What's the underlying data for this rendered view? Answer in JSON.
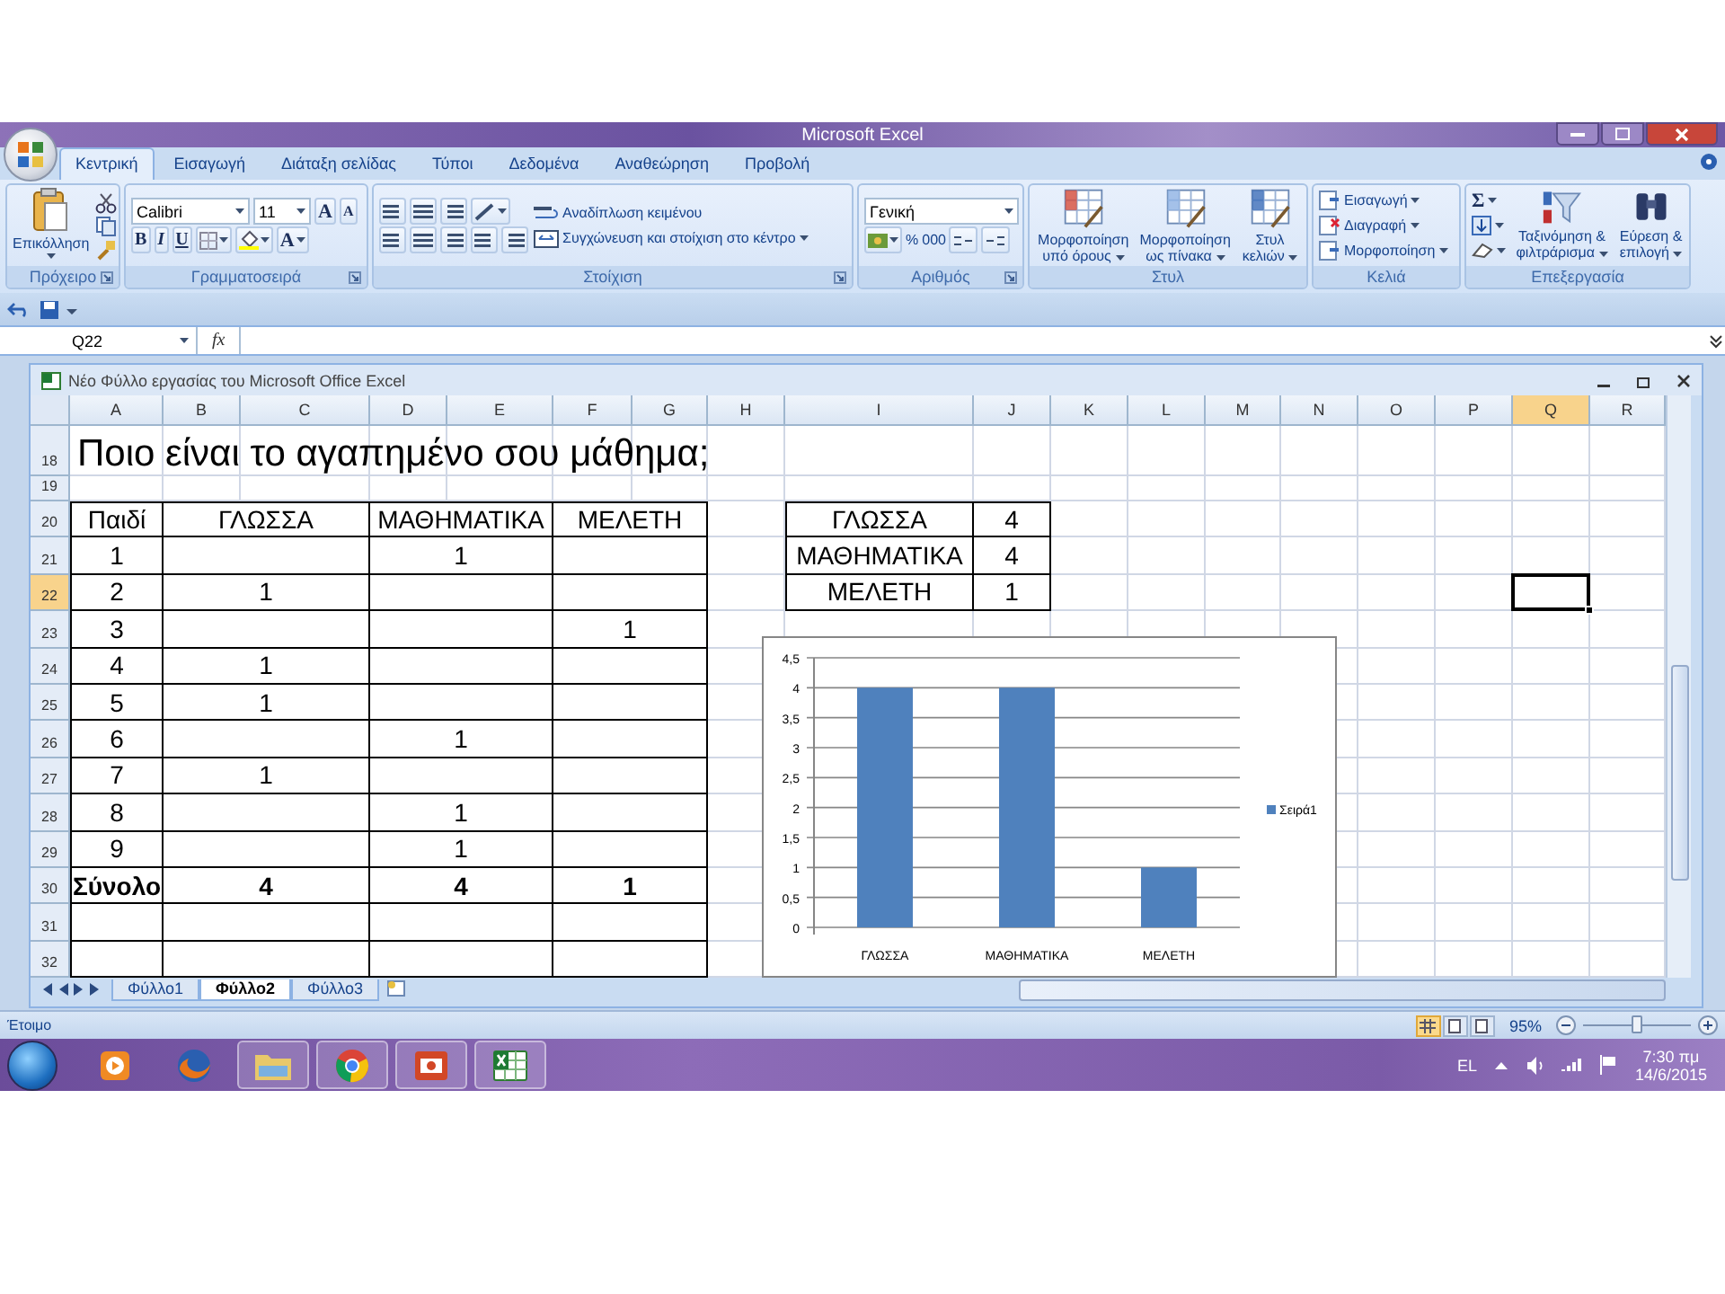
{
  "window": {
    "title": "Microsoft Excel"
  },
  "ribbon": {
    "tabs": [
      {
        "label": "Κεντρική",
        "selected": true
      },
      {
        "label": "Εισαγωγή",
        "selected": false
      },
      {
        "label": "Διάταξη σελίδας",
        "selected": false
      },
      {
        "label": "Τύποι",
        "selected": false
      },
      {
        "label": "Δεδομένα",
        "selected": false
      },
      {
        "label": "Αναθεώρηση",
        "selected": false
      },
      {
        "label": "Προβολή",
        "selected": false
      }
    ],
    "groups": [
      {
        "kind": "clipboard",
        "label": "Πρόχειρο",
        "launcher": true,
        "paste": "Επικόλληση"
      },
      {
        "kind": "font",
        "label": "Γραμματοσειρά",
        "launcher": true,
        "font": "Calibri",
        "size": "11",
        "grow": "A",
        "shrink": "A",
        "styles": [
          "B",
          "I",
          "U"
        ],
        "color_letter": "A"
      },
      {
        "kind": "alignment",
        "label": "Στοίχιση",
        "launcher": true,
        "wrap": "Αναδίπλωση κειμένου",
        "merge": "Συγχώνευση και στοίχιση στο κέντρο"
      },
      {
        "kind": "number",
        "label": "Αριθμός",
        "launcher": true,
        "format": "Γενική",
        "percent": "%",
        "thousands": "000"
      },
      {
        "kind": "styles",
        "label": "Στυλ",
        "launcher": false,
        "buttons": [
          "Μορφοποίηση υπό όρους",
          "Μορφοποίηση ως πίνακα",
          "Στυλ κελιών"
        ]
      },
      {
        "kind": "cells",
        "label": "Κελιά",
        "launcher": false,
        "buttons": [
          "Εισαγωγή",
          "Διαγραφή",
          "Μορφοποίηση"
        ]
      },
      {
        "kind": "editing",
        "label": "Επεξεργασία",
        "launcher": false,
        "sum": "Σ",
        "buttons": [
          "Ταξινόμηση & φιλτράρισμα",
          "Εύρεση & επιλογή"
        ]
      }
    ]
  },
  "formula_bar": {
    "name_box": "Q22",
    "function_label": "fx"
  },
  "workbook": {
    "title": "Νέο Φύλλο εργασίας του Microsoft Office Excel",
    "columns": [
      {
        "label": "A",
        "selected": false
      },
      {
        "label": "B",
        "selected": false
      },
      {
        "label": "C",
        "selected": false
      },
      {
        "label": "D",
        "selected": false
      },
      {
        "label": "E",
        "selected": false
      },
      {
        "label": "F",
        "selected": false
      },
      {
        "label": "G",
        "selected": false
      },
      {
        "label": "H",
        "selected": false
      },
      {
        "label": "I",
        "selected": false
      },
      {
        "label": "J",
        "selected": false
      },
      {
        "label": "K",
        "selected": false
      },
      {
        "label": "L",
        "selected": false
      },
      {
        "label": "M",
        "selected": false
      },
      {
        "label": "N",
        "selected": false
      },
      {
        "label": "O",
        "selected": false
      },
      {
        "label": "P",
        "selected": false
      },
      {
        "label": "Q",
        "selected": true
      },
      {
        "label": "R",
        "selected": false
      }
    ],
    "rows": [
      {
        "label": "18",
        "selected": false
      },
      {
        "label": "19",
        "selected": false
      },
      {
        "label": "20",
        "selected": false
      },
      {
        "label": "21",
        "selected": false
      },
      {
        "label": "22",
        "selected": true
      },
      {
        "label": "23",
        "selected": false
      },
      {
        "label": "24",
        "selected": false
      },
      {
        "label": "25",
        "selected": false
      },
      {
        "label": "26",
        "selected": false
      },
      {
        "label": "27",
        "selected": false
      },
      {
        "label": "28",
        "selected": false
      },
      {
        "label": "29",
        "selected": false
      },
      {
        "label": "30",
        "selected": false
      },
      {
        "label": "31",
        "selected": false
      },
      {
        "label": "32",
        "selected": false
      }
    ],
    "title_cell": "Ποιο είναι το αγαπημένο σου μάθημα;",
    "table": {
      "columns": [
        "Παιδί",
        "ΓΛΩΣΣΑ",
        "ΜΑΘΗΜΑΤΙΚΑ",
        "ΜΕΛΕΤΗ"
      ],
      "rows": [
        {
          "kind": "data",
          "cells": [
            "1",
            null,
            "1",
            null
          ]
        },
        {
          "kind": "data",
          "cells": [
            "2",
            "1",
            null,
            null
          ]
        },
        {
          "kind": "data",
          "cells": [
            "3",
            null,
            null,
            "1"
          ]
        },
        {
          "kind": "data",
          "cells": [
            "4",
            "1",
            null,
            null
          ]
        },
        {
          "kind": "data",
          "cells": [
            "5",
            "1",
            null,
            null
          ]
        },
        {
          "kind": "data",
          "cells": [
            "6",
            null,
            "1",
            null
          ]
        },
        {
          "kind": "data",
          "cells": [
            "7",
            "1",
            null,
            null
          ]
        },
        {
          "kind": "data",
          "cells": [
            "8",
            null,
            "1",
            null
          ]
        },
        {
          "kind": "data",
          "cells": [
            "9",
            null,
            "1",
            null
          ]
        },
        {
          "kind": "total",
          "cells": [
            "Σύνολο",
            "4",
            "4",
            "1"
          ]
        },
        {
          "kind": "blank"
        },
        {
          "kind": "blank"
        }
      ]
    },
    "summary": [
      {
        "label": "ΓΛΩΣΣΑ",
        "value": "4"
      },
      {
        "label": "ΜΑΘΗΜΑΤΙΚΑ",
        "value": "4"
      },
      {
        "label": "ΜΕΛΕΤΗ",
        "value": "1"
      }
    ],
    "chart_data": {
      "type": "bar",
      "grid": true,
      "categories": [
        "ΓΛΩΣΣΑ",
        "ΜΑΘΗΜΑΤΙΚΑ",
        "ΜΕΛΕΤΗ"
      ],
      "series": [
        {
          "name": "Σειρά1",
          "color": "#4f81bd",
          "values": [
            4,
            4,
            1
          ]
        }
      ],
      "ylim": [
        0,
        4.5
      ],
      "yticks": [
        0,
        {
          "value": 0.5,
          "label": "0,5"
        },
        1,
        {
          "value": 1.5,
          "label": "1,5"
        },
        2,
        {
          "value": 2.5,
          "label": "2,5"
        },
        3,
        {
          "value": 3.5,
          "label": "3,5"
        },
        4,
        {
          "value": 4.5,
          "label": "4,5"
        }
      ]
    },
    "sheet_tabs": [
      {
        "label": "Φύλλο1",
        "selected": false
      },
      {
        "label": "Φύλλο2",
        "selected": true
      },
      {
        "label": "Φύλλο3",
        "selected": false
      }
    ]
  },
  "status_bar": {
    "text": "Έτοιμο",
    "views": [
      {
        "kind": "normal",
        "selected": true
      },
      {
        "kind": "layout",
        "selected": false
      },
      {
        "kind": "breaks",
        "selected": false
      }
    ],
    "zoom": "95%",
    "zoom_slider": {
      "level": 0.5
    }
  },
  "taskbar": {
    "apps": [
      {
        "kind": "media",
        "running": false
      },
      {
        "kind": "fox",
        "running": false
      },
      {
        "kind": "folder",
        "running": true
      },
      {
        "kind": "chrome",
        "running": true
      },
      {
        "kind": "slides",
        "running": true
      },
      {
        "kind": "sheet",
        "running": true
      }
    ],
    "language": "EL",
    "time": "7:30 πμ",
    "date": "14/6/2015"
  }
}
